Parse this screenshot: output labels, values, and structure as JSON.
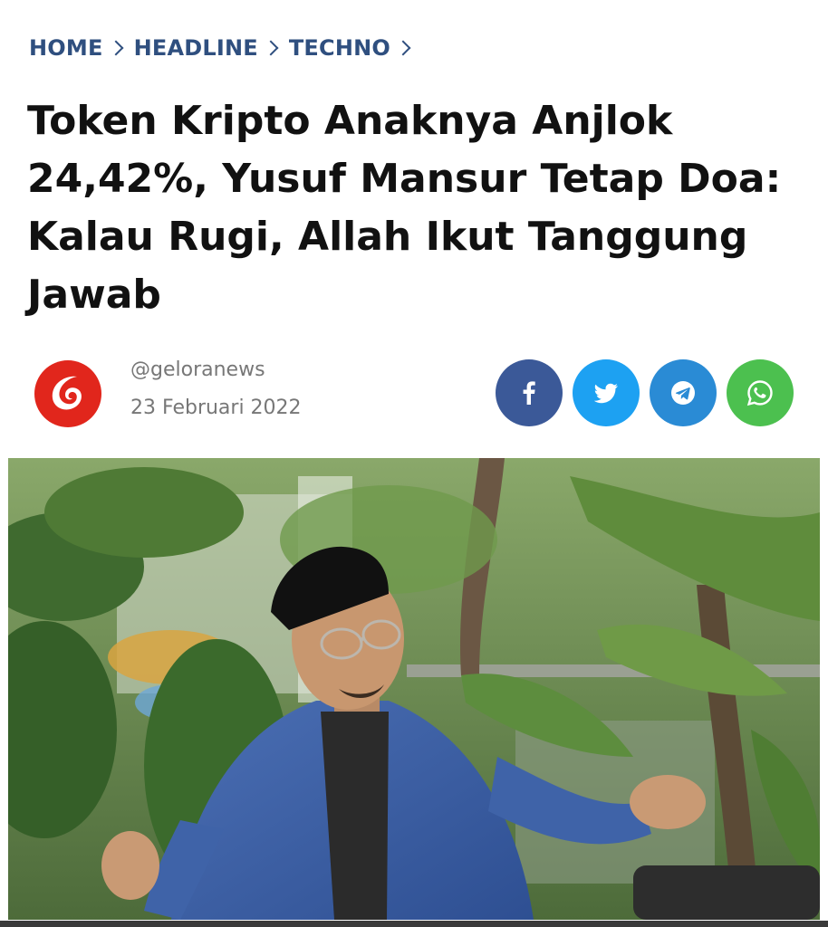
{
  "breadcrumb": {
    "items": [
      "HOME",
      "HEADLINE",
      "TECHNO"
    ]
  },
  "article": {
    "title": "Token Kripto Anaknya Anjlok 24,42%, Yusuf Mansur Tetap Doa: Kalau Rugi, Allah Ikut Tanggung Jawab",
    "author": "@geloranews",
    "date": "23 Februari 2022"
  },
  "share": {
    "icons": [
      "facebook-icon",
      "twitter-icon",
      "telegram-icon",
      "whatsapp-icon"
    ]
  },
  "colors": {
    "breadcrumb": "#2f4f7f",
    "logo_red": "#e1261c",
    "facebook": "#3b5998",
    "twitter": "#1da1f2",
    "telegram": "#2a8bd5",
    "whatsapp": "#4cc04f"
  }
}
